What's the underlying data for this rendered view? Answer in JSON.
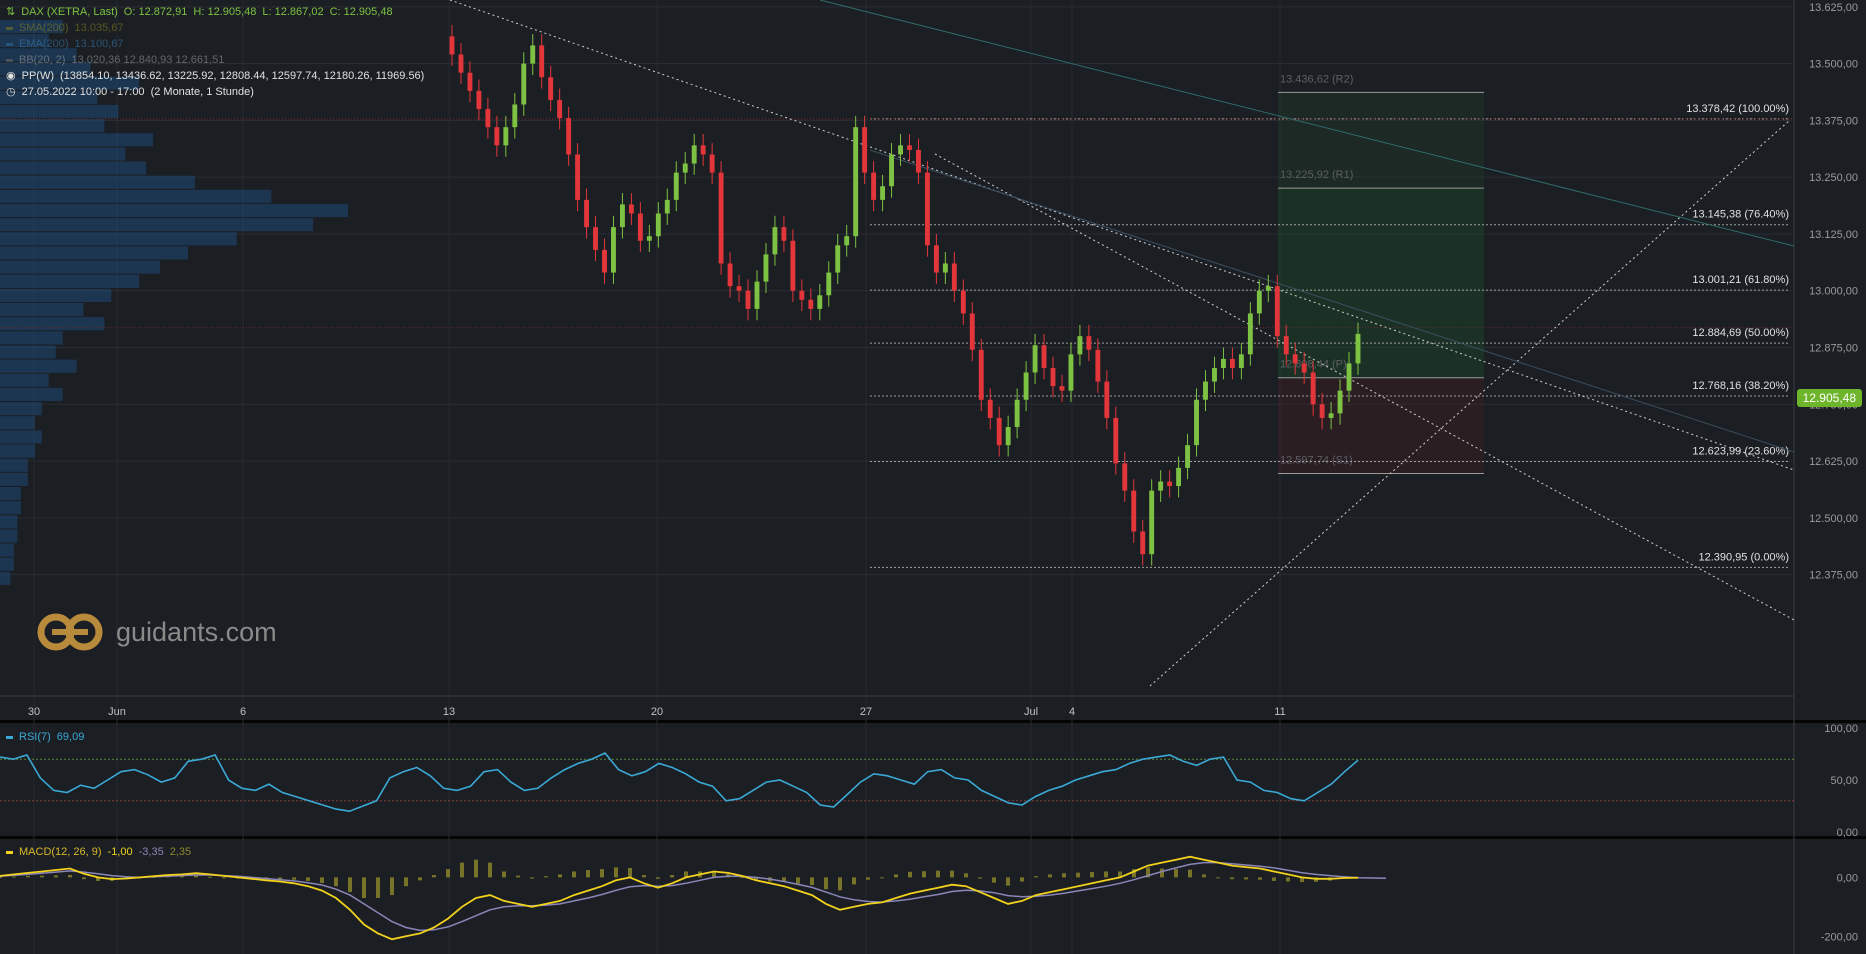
{
  "chart_data": [
    {
      "type": "candlestick",
      "title": "DAX (XETRA, Last)",
      "ohlc_readout": {
        "open": "O: 12.872,91",
        "high": "H: 12.905,48",
        "low": "L: 12.867,02",
        "close": "C: 12.905,48"
      },
      "ylim": [
        12350,
        13640
      ],
      "y_ticks": [
        "13.625,00",
        "13.500,00",
        "13.375,00",
        "13.250,00",
        "13.125,00",
        "13.000,00",
        "12.875,00",
        "12.750,00",
        "12.625,00",
        "12.500,00",
        "12.375,00"
      ],
      "x_ticks": [
        "30",
        "Jun",
        "6",
        "13",
        "20",
        "27",
        "Jul",
        "4",
        "11"
      ],
      "last_price": "12.905,48",
      "closes": [
        13520,
        13480,
        13440,
        13400,
        13360,
        13320,
        13360,
        13410,
        13500,
        13540,
        13470,
        13420,
        13380,
        13300,
        13200,
        13140,
        13090,
        13040,
        13140,
        13190,
        13170,
        13110,
        13120,
        13170,
        13200,
        13260,
        13280,
        13320,
        13300,
        13260,
        13060,
        13010,
        13000,
        12960,
        13020,
        13080,
        13140,
        13110,
        13000,
        12980,
        12960,
        12990,
        13040,
        13100,
        13120,
        13360,
        13260,
        13200,
        13230,
        13300,
        13320,
        13310,
        13260,
        13100,
        13040,
        13060,
        13000,
        12950,
        12870,
        12760,
        12720,
        12660,
        12700,
        12760,
        12820,
        12880,
        12830,
        12790,
        12780,
        12860,
        12900,
        12870,
        12800,
        12720,
        12620,
        12560,
        12470,
        12420,
        12560,
        12580,
        12570,
        12610,
        12660,
        12760,
        12800,
        12830,
        12850,
        12830,
        12860,
        12950,
        13000,
        13010,
        12900,
        12860,
        12840,
        12820,
        12750,
        12720,
        12730,
        12780,
        12840,
        12905
      ],
      "indicators": [
        {
          "label": "SMA(200)",
          "value": "13.035,67",
          "color": "#7d7a1e"
        },
        {
          "label": "EMA(200)",
          "value": "13.100,67",
          "color": "#2f6b9a"
        },
        {
          "label": "BB(20, 2)",
          "value": "13.020,36  12.840,93  12.661,51",
          "color": "#6b6b6b"
        }
      ],
      "pivot_points": {
        "label": "PP(W)",
        "values": "(13854.10, 13436.62, 13225.92, 12808.44, 12597.74, 12180.26, 11969.56)",
        "lines": [
          {
            "label": "13.436,62 (R2)",
            "value": 13436.62
          },
          {
            "label": "13.225,92 (R1)",
            "value": 13225.92
          },
          {
            "label": "12.808,44 (P)",
            "value": 12808.44
          },
          {
            "label": "12.597,74 (S1)",
            "value": 12597.74
          }
        ]
      },
      "period": {
        "label": "27.05.2022 10:00 - 17:00",
        "detail": "(2 Monate, 1 Stunde)"
      },
      "fibonacci": [
        {
          "label": "13.378,42 (100.00%)",
          "value": 13378.42
        },
        {
          "label": "13.145,38 (76.40%)",
          "value": 13145.38
        },
        {
          "label": "13.001,21 (61.80%)",
          "value": 13001.21
        },
        {
          "label": "12.884,69 (50.00%)",
          "value": 12884.69
        },
        {
          "label": "12.768,16 (38.20%)",
          "value": 12768.16
        },
        {
          "label": "12.623,99 (23.60%)",
          "value": 12623.99
        },
        {
          "label": "12.390,95 (0.00%)",
          "value": 12390.95
        }
      ],
      "volume_profile": [
        18,
        14,
        22,
        26,
        40,
        28,
        34,
        30,
        44,
        36,
        42,
        56,
        78,
        100,
        90,
        68,
        54,
        46,
        40,
        32,
        24,
        30,
        18,
        16,
        22,
        14,
        18,
        12,
        10,
        12,
        10,
        8,
        8,
        6,
        6,
        5,
        5,
        4,
        4,
        3
      ]
    },
    {
      "type": "line",
      "title": "RSI(7)",
      "value": "69,09",
      "ylim": [
        0,
        100
      ],
      "y_ticks": [
        "100,00",
        "50,00",
        "0,00"
      ],
      "levels": [
        70,
        30
      ],
      "values": [
        72,
        70,
        74,
        52,
        40,
        38,
        45,
        42,
        50,
        58,
        60,
        55,
        48,
        52,
        68,
        70,
        74,
        50,
        42,
        40,
        46,
        38,
        34,
        30,
        26,
        22,
        20,
        25,
        30,
        52,
        58,
        62,
        54,
        42,
        40,
        44,
        58,
        60,
        48,
        40,
        42,
        52,
        60,
        66,
        70,
        76,
        60,
        54,
        58,
        66,
        62,
        56,
        48,
        44,
        30,
        32,
        40,
        48,
        50,
        44,
        38,
        26,
        24,
        36,
        48,
        56,
        54,
        50,
        46,
        58,
        60,
        52,
        50,
        40,
        34,
        28,
        26,
        34,
        40,
        44,
        50,
        54,
        58,
        60,
        66,
        70,
        72,
        74,
        68,
        64,
        70,
        72,
        50,
        48,
        40,
        38,
        32,
        30,
        38,
        46,
        58,
        69
      ]
    },
    {
      "type": "line",
      "title": "MACD(12, 26, 9)",
      "values_label": "-1,00",
      "signal_label": "-3,35",
      "hist_label": "2,35",
      "ylim": [
        -260,
        120
      ],
      "y_ticks": [
        "0,00",
        "-200,00"
      ],
      "macd": [
        5,
        10,
        15,
        20,
        25,
        30,
        12,
        0,
        -6,
        -4,
        0,
        4,
        8,
        10,
        14,
        10,
        5,
        0,
        -5,
        -10,
        -14,
        -20,
        -30,
        -45,
        -70,
        -110,
        -160,
        -190,
        -210,
        -200,
        -190,
        -170,
        -140,
        -100,
        -70,
        -60,
        -80,
        -90,
        -100,
        -90,
        -80,
        -60,
        -45,
        -30,
        -10,
        0,
        -20,
        -35,
        -20,
        0,
        10,
        20,
        15,
        5,
        -10,
        -20,
        -30,
        -45,
        -60,
        -90,
        -110,
        -100,
        -90,
        -85,
        -70,
        -55,
        -45,
        -35,
        -25,
        -30,
        -50,
        -70,
        -90,
        -80,
        -60,
        -50,
        -40,
        -30,
        -20,
        -10,
        0,
        20,
        40,
        50,
        60,
        70,
        60,
        50,
        40,
        35,
        30,
        20,
        10,
        0,
        -5,
        -5,
        -2,
        -1
      ],
      "signal": [
        4,
        7,
        10,
        14,
        18,
        22,
        18,
        12,
        6,
        2,
        0,
        2,
        4,
        6,
        8,
        8,
        6,
        4,
        0,
        -4,
        -8,
        -12,
        -18,
        -26,
        -40,
        -60,
        -90,
        -120,
        -150,
        -170,
        -180,
        -178,
        -168,
        -150,
        -130,
        -110,
        -100,
        -96,
        -96,
        -94,
        -90,
        -80,
        -70,
        -58,
        -44,
        -32,
        -28,
        -30,
        -28,
        -20,
        -10,
        0,
        4,
        4,
        0,
        -6,
        -14,
        -24,
        -34,
        -50,
        -66,
        -76,
        -82,
        -84,
        -80,
        -74,
        -66,
        -58,
        -48,
        -44,
        -46,
        -52,
        -62,
        -66,
        -64,
        -60,
        -54,
        -46,
        -38,
        -30,
        -20,
        -8,
        6,
        20,
        32,
        44,
        50,
        50,
        46,
        42,
        38,
        32,
        24,
        16,
        10,
        6,
        2,
        -1,
        -2,
        -3
      ]
    }
  ],
  "branding": {
    "name": "guidants.com"
  }
}
